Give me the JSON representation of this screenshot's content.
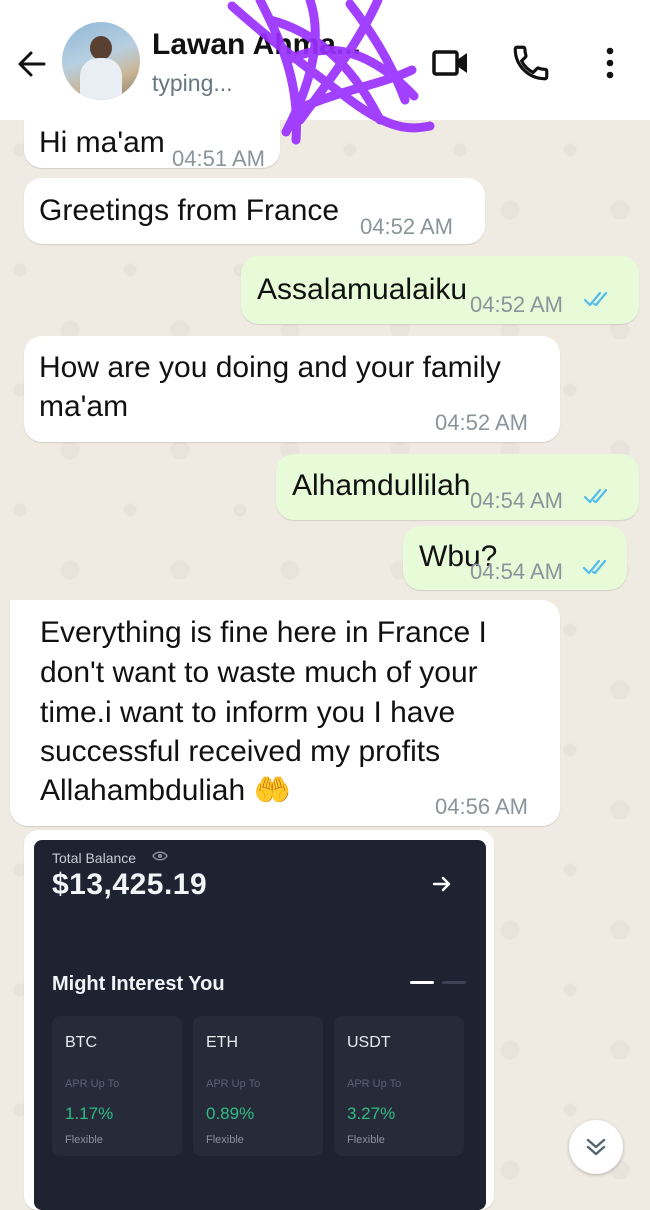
{
  "header": {
    "contact_name": "Lawan Ahma...",
    "status": "typing..."
  },
  "messages": [
    {
      "direction": "in",
      "text": "Hi ma'am",
      "time": "04:51 AM"
    },
    {
      "direction": "in",
      "text": "Greetings from France",
      "time": "04:52 AM"
    },
    {
      "direction": "out",
      "text": "Assalamualaiku",
      "time": "04:52 AM",
      "status": "read"
    },
    {
      "direction": "in",
      "lines": [
        "How are you doing and your family",
        "ma'am"
      ],
      "time": "04:52 AM"
    },
    {
      "direction": "out",
      "text": "Alhamdullilah",
      "time": "04:54 AM",
      "status": "read"
    },
    {
      "direction": "out",
      "text": "Wbu?",
      "time": "04:54 AM",
      "status": "read"
    },
    {
      "direction": "in",
      "lines": [
        "Everything is fine here in France I",
        "don't want to waste much of your",
        "time.i want to inform you I have",
        "successful received my profits",
        "Allahambduliah 🤲"
      ],
      "time": "04:56 AM"
    }
  ],
  "image": {
    "total_balance_label": "Total Balance",
    "total_balance_value": "$13,425.19",
    "section_title": "Might Interest You",
    "coins": [
      {
        "symbol": "BTC",
        "apr_label": "APR Up To",
        "rate": "1.17%",
        "type": "Flexible"
      },
      {
        "symbol": "ETH",
        "apr_label": "APR Up To",
        "rate": "0.89%",
        "type": "Flexible"
      },
      {
        "symbol": "USDT",
        "apr_label": "APR Up To",
        "rate": "3.27%",
        "type": "Flexible"
      }
    ]
  },
  "colors": {
    "chat_background": "#efeae2",
    "incoming_bubble": "#ffffff",
    "outgoing_bubble": "#e8fbd9",
    "read_ticks": "#53bdeb",
    "scribble": "#9b30ff",
    "wallet_background": "#1f2230",
    "rate_green": "#2ebd85"
  },
  "icons": {
    "back": "arrow-left-icon",
    "video": "video-camera-icon",
    "call": "phone-icon",
    "menu": "more-vert-icon",
    "read_receipt": "double-check-icon",
    "eye": "eye-icon",
    "arrow": "arrow-right-icon",
    "scroll_down": "chevron-double-down-icon"
  }
}
